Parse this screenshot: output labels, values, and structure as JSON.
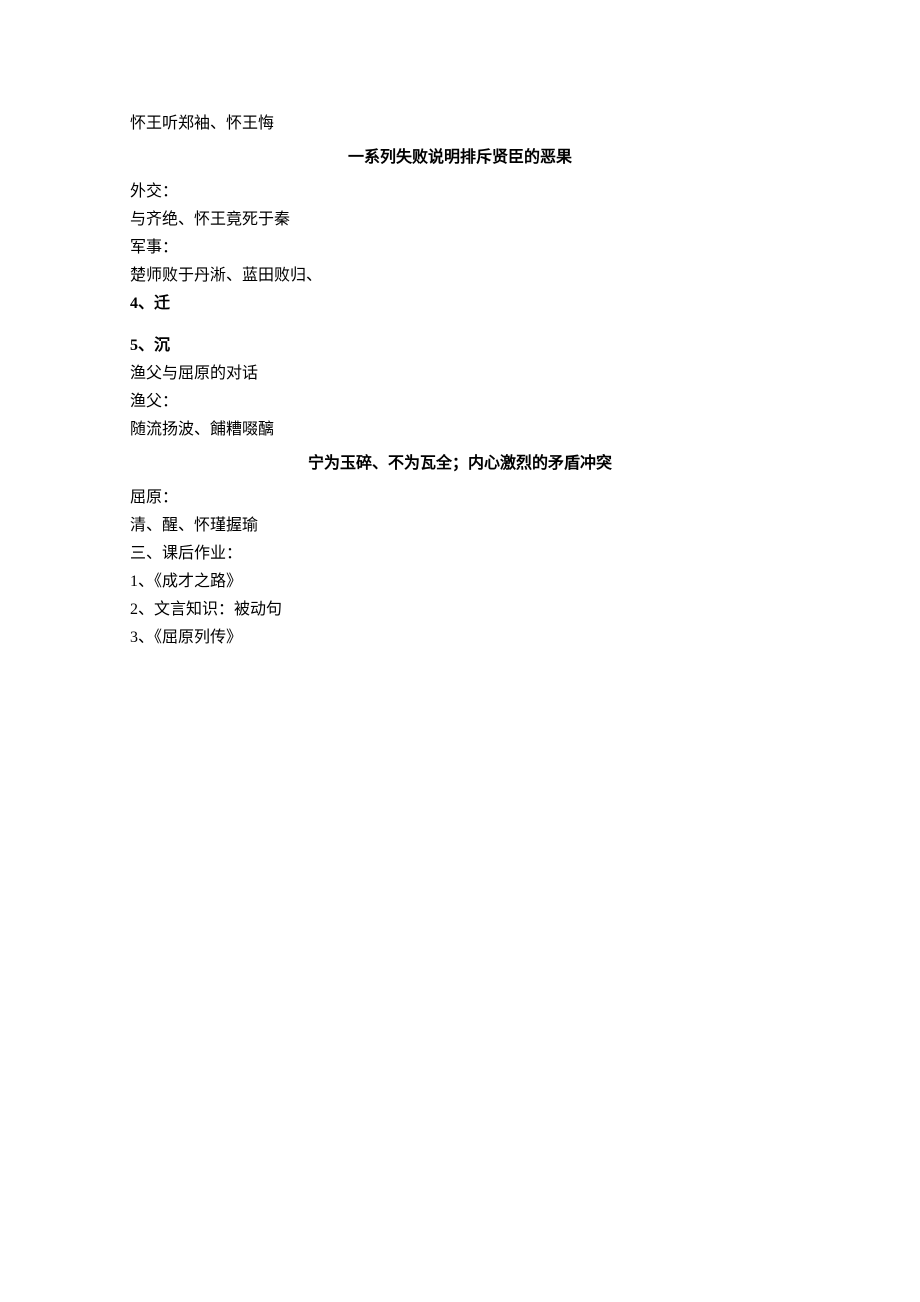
{
  "line1": "怀王听郑袖、怀王悔",
  "heading1": "一系列失败说明排斥贤臣的恶果",
  "diplomacy_label": "外交：",
  "diplomacy_text": "与齐绝、怀王竟死于秦",
  "military_label": "军事：",
  "military_text": "楚师败于丹淅、蓝田败归、",
  "section4": "4、迁",
  "section5": "5、沉",
  "fisherman_dialogue": "渔父与屈原的对话",
  "fisherman_label": "渔父：",
  "fisherman_text": "随流扬波、餔糟啜醨",
  "heading2": "宁为玉碎、不为瓦全；内心激烈的矛盾冲突",
  "quyuan_label": "屈原：",
  "quyuan_text": "清、醒、怀瑾握瑜",
  "homework_title": "三、课后作业：",
  "homework1": "1、《成才之路》",
  "homework2": "2、文言知识：被动句",
  "homework3": "3、《屈原列传》"
}
